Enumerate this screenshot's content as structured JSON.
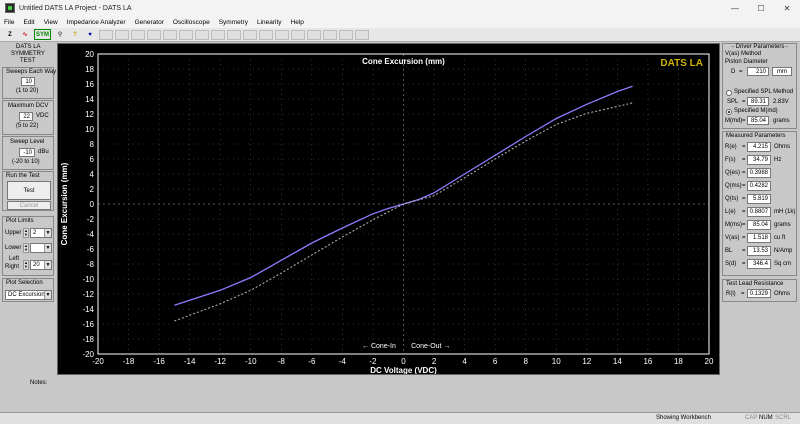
{
  "window": {
    "title": "Untitled DATS LA Project - DATS LA",
    "controls": [
      "—",
      "☐",
      "✕"
    ]
  },
  "menu": [
    "File",
    "Edit",
    "View",
    "Impedance Analyzer",
    "Generator",
    "Oscilloscope",
    "Symmetry",
    "Linearity",
    "Help"
  ],
  "toolbar": {
    "buttons": [
      {
        "label": "Z",
        "icon": "impedance-icon"
      },
      {
        "label": "∿",
        "icon": "sine-wave-icon"
      },
      {
        "label": "SYM",
        "icon": "symmetry-icon"
      },
      {
        "label": "⚲",
        "icon": "probe-icon"
      },
      {
        "label": "?",
        "icon": "help-icon"
      },
      {
        "label": "♥",
        "icon": "context-help-icon"
      }
    ]
  },
  "left_panel": {
    "heading": [
      "DATS LA",
      "SYMMETRY",
      "TEST"
    ],
    "sweeps_each_way": {
      "label": "Sweeps Each Way",
      "value": "10",
      "range": "(1 to 20)"
    },
    "max_dcv": {
      "label": "Maximum DCV",
      "value": "22",
      "unit": "VDC",
      "range": "(5 to 22)"
    },
    "sweep_level": {
      "label": "Sweep Level",
      "value": "-10",
      "unit": "dBu",
      "range": "(-20 to 10)"
    },
    "run": {
      "label": "Run the Test",
      "test_button": "Test",
      "cancel_button": "Cancel"
    },
    "plot_limits": {
      "label": "Plot Limits",
      "upper_label": "Upper",
      "upper_value": "2",
      "lower_label": "Lower",
      "lower_value": "",
      "leftright_label": [
        "Left",
        "Right"
      ],
      "leftright_value": "20"
    },
    "plot_selection": {
      "label": "Plot Selection",
      "value": "DC Excursion"
    }
  },
  "chart_data": {
    "type": "line",
    "title": "Cone Excursion (mm)",
    "watermark": "DATS LA",
    "xlabel": "DC Voltage (VDC)",
    "ylabel": "Cone Excursion (mm)",
    "xlim": [
      -20,
      20
    ],
    "ylim": [
      -20,
      20
    ],
    "xticks": [
      -20,
      -18,
      -16,
      -14,
      -12,
      -10,
      -8,
      -6,
      -4,
      -2,
      0,
      2,
      4,
      6,
      8,
      10,
      12,
      14,
      16,
      18,
      20
    ],
    "yticks": [
      -20,
      -18,
      -16,
      -14,
      -12,
      -10,
      -8,
      -6,
      -4,
      -2,
      0,
      2,
      4,
      6,
      8,
      10,
      12,
      14,
      16,
      18,
      20
    ],
    "grid": true,
    "annotations": {
      "left": "← Cone-In",
      "right": "Cone-Out →"
    },
    "colors": {
      "measured": "#8c7cff",
      "dashed": "#bbbbbb",
      "axis": "#ffffff",
      "grid": "#555555"
    },
    "series": [
      {
        "style": "solid",
        "x": [
          -15,
          -12,
          -10,
          -8,
          -6,
          -4,
          -2,
          -1,
          0,
          1,
          2,
          4,
          6,
          8,
          10,
          12,
          14,
          15
        ],
        "y": [
          -13.5,
          -11.5,
          -9.8,
          -7.5,
          -5.2,
          -3.2,
          -1.3,
          -0.6,
          0,
          0.6,
          1.5,
          4.0,
          6.5,
          9.0,
          11.4,
          13.3,
          15.0,
          15.7
        ]
      },
      {
        "style": "dashed",
        "x": [
          -15,
          -12,
          -10,
          -8,
          -6,
          -4,
          -2,
          0,
          2,
          4,
          6,
          8,
          10,
          12,
          14,
          15
        ],
        "y": [
          -15.6,
          -13.3,
          -11.5,
          -9.2,
          -6.8,
          -4.4,
          -2.1,
          0,
          1.1,
          3.5,
          6.0,
          8.4,
          10.6,
          12.1,
          13.0,
          13.5
        ]
      }
    ]
  },
  "right_panel": {
    "driver_params_label": "- Driver Parameters -",
    "method_label": "V(as) Method",
    "piston_label": "Piston Diameter",
    "piston": {
      "name": "D",
      "value": "210",
      "unit": "mm"
    },
    "spl_method": {
      "label": "Specified SPL Method",
      "name": "SPL",
      "value": "89.31",
      "unit": "2.83V"
    },
    "mmd_method": {
      "label": "Specified M(md)",
      "name": "M(md)",
      "value": "85.04",
      "unit": "grams"
    },
    "measured_label": "Measured Parameters",
    "measured": [
      {
        "name": "R(e)",
        "value": "4.215",
        "unit": "Ohms"
      },
      {
        "name": "F(s)",
        "value": "34.79",
        "unit": "Hz"
      },
      {
        "name": "Q(es)",
        "value": "0.3988",
        "unit": ""
      },
      {
        "name": "Q(ms)",
        "value": "0.4282",
        "unit": ""
      },
      {
        "name": "Q(ts)",
        "value": "5.819",
        "unit": ""
      },
      {
        "name": "L(e)",
        "value": "0.8807",
        "unit": "mH (1k)"
      },
      {
        "name": "M(ms)",
        "value": "85.04",
        "unit": "grams"
      },
      {
        "name": "V(as)",
        "value": "1.518",
        "unit": "cu ft"
      },
      {
        "name": "BL",
        "value": "13.53",
        "unit": "N/Amp"
      },
      {
        "name": "S(d)",
        "value": "346.4",
        "unit": "Sq cm"
      }
    ],
    "lead_label": "Test Lead Resistance",
    "lead": {
      "name": "R(l)",
      "value": "0.1329",
      "unit": "Ohms"
    }
  },
  "notes": {
    "label": "Notes:"
  },
  "status": {
    "text": "Showing Workbench",
    "indicators": [
      "CAP",
      "NUM",
      "SCRL"
    ]
  }
}
